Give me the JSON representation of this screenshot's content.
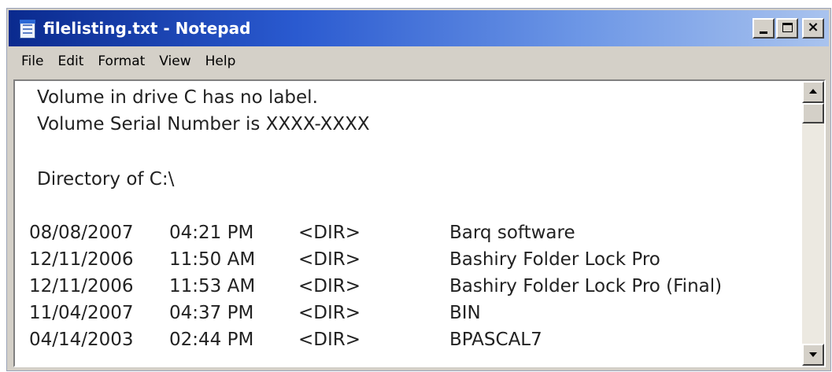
{
  "window": {
    "title": "filelisting.txt - Notepad",
    "controls": {
      "minimize_icon": "minimize-icon",
      "maximize_icon": "maximize-icon",
      "close_label": "×"
    }
  },
  "menu": {
    "items": [
      {
        "label": "File"
      },
      {
        "label": "Edit"
      },
      {
        "label": "Format"
      },
      {
        "label": "View"
      },
      {
        "label": "Help"
      }
    ]
  },
  "document": {
    "header_lines": [
      "Volume in drive C has no label.",
      "Volume Serial Number is XXXX-XXXX",
      "Directory of C:\\"
    ],
    "entries": [
      {
        "date": "08/08/2007",
        "time": "04:21 PM",
        "type": "<DIR>",
        "name": "Barq software"
      },
      {
        "date": "12/11/2006",
        "time": "11:50 AM",
        "type": "<DIR>",
        "name": "Bashiry Folder Lock Pro"
      },
      {
        "date": "12/11/2006",
        "time": "11:53 AM",
        "type": "<DIR>",
        "name": "Bashiry Folder Lock Pro (Final)"
      },
      {
        "date": "11/04/2007",
        "time": "04:37 PM",
        "type": "<DIR>",
        "name": "BIN"
      },
      {
        "date": "04/14/2003",
        "time": "02:44 PM",
        "type": "<DIR>",
        "name": "BPASCAL7"
      }
    ]
  },
  "colors": {
    "titlebar_start": "#0a2a8e",
    "titlebar_end": "#a9c3ee",
    "chrome": "#d4d0c8",
    "text": "#222222"
  }
}
